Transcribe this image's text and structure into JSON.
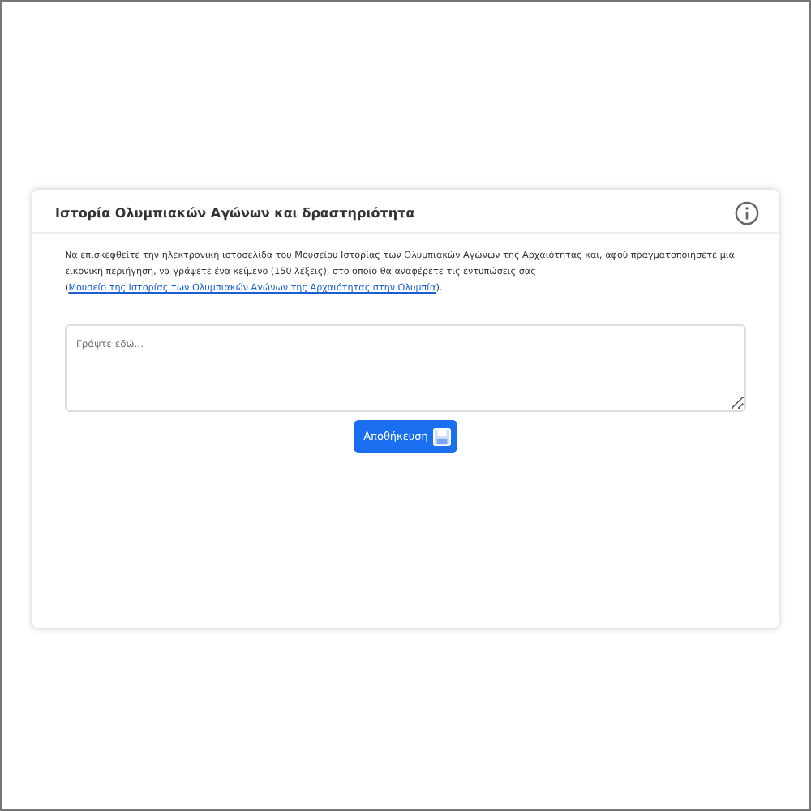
{
  "card": {
    "title": "Ιστορία Ολυμπιακών Αγώνων και δραστηριότητα",
    "instructions": "Να επισκεφθείτε την ηλεκτρονική ιστοσελίδα του Μουσείου Ιστορίας των Ολυμπιακών Αγώνων της Αρχαιότητας και, αφού πραγματοποιήσετε μια εικονική περιήγηση, να γράψετε ένα κείμενο (150 λέξεις), στο οποίο θα αναφέρετε τις εντυπώσεις σας (",
    "link": "Μουσείο της Ιστορίας των Ολυμπιακών Αγώνων της Αρχαιότητας στην Ολυμπία",
    "instructions_end": ").",
    "answer": {
      "placeholder": "Γράψτε εδώ..."
    },
    "save_button": "Αποθήκευση"
  }
}
